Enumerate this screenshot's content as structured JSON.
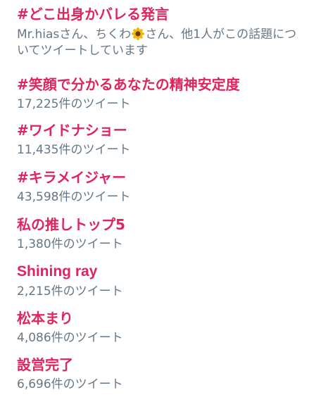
{
  "trends": [
    {
      "title": "#どこ出身かバレる発言",
      "context": {
        "before": "Mr.hiasさん、ちくわ",
        "icon": "sunflower-icon",
        "after": "さん、他1人がこの話題についてツイートしています"
      }
    },
    {
      "title": "#笑顔で分かるあなたの精神安定度",
      "count": "17,225件のツイート"
    },
    {
      "title": "#ワイドナショー",
      "count": "11,435件のツイート"
    },
    {
      "title": "#キラメイジャー",
      "count": "43,598件のツイート"
    },
    {
      "title": "私の推しトップ5",
      "count": "1,380件のツイート"
    },
    {
      "title": "Shining ray",
      "count": "2,215件のツイート"
    },
    {
      "title": "松本まり",
      "count": "4,086件のツイート"
    },
    {
      "title": "設営完了",
      "count": "6,696件のツイート"
    }
  ],
  "colors": {
    "trend_title": "#e0245e",
    "meta_text": "#657786",
    "background": "#ffffff"
  }
}
